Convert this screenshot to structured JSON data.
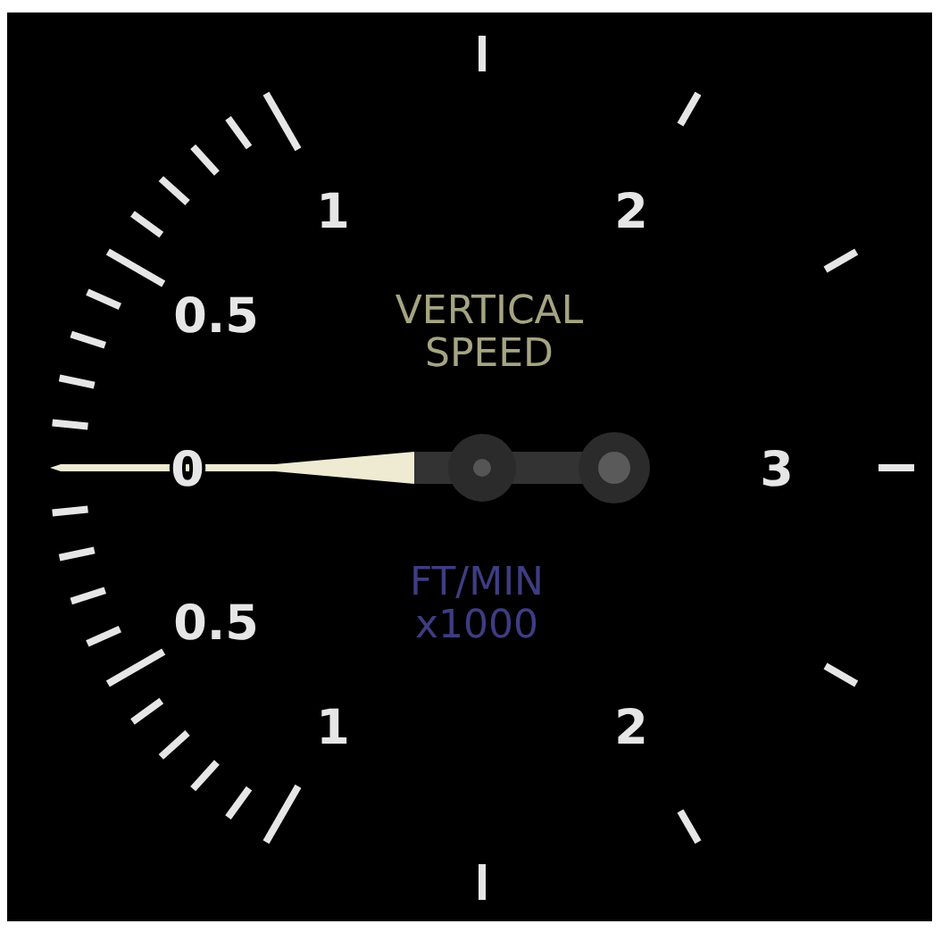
{
  "gauge": {
    "title_lines": [
      "VERTICAL",
      "SPEED"
    ],
    "unit_lines": [
      "FT/MIN",
      "x1000"
    ],
    "scale_labels": [
      "1",
      "2",
      "0.5",
      "0",
      "3",
      "0.5",
      "1",
      "2"
    ]
  }
}
